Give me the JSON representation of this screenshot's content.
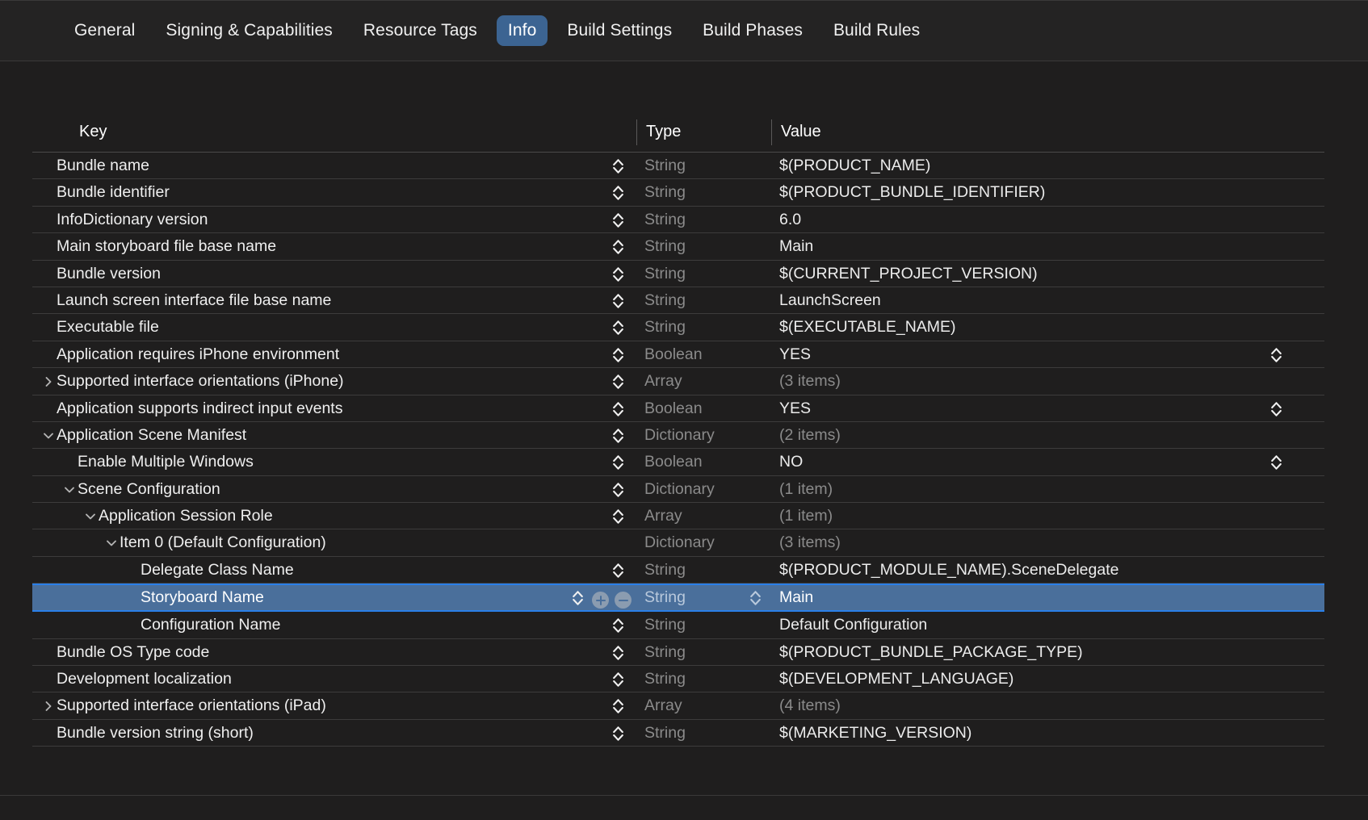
{
  "tabs": [
    {
      "label": "General",
      "active": false
    },
    {
      "label": "Signing & Capabilities",
      "active": false
    },
    {
      "label": "Resource Tags",
      "active": false
    },
    {
      "label": "Info",
      "active": true
    },
    {
      "label": "Build Settings",
      "active": false
    },
    {
      "label": "Build Phases",
      "active": false
    },
    {
      "label": "Build Rules",
      "active": false
    }
  ],
  "table": {
    "headers": {
      "key": "Key",
      "type": "Type",
      "value": "Value"
    },
    "rows": [
      {
        "key": "Bundle name",
        "type": "String",
        "value": "$(PRODUCT_NAME)",
        "indent": 0,
        "disclosure": "none",
        "value_muted": false,
        "selected": false,
        "has_key_stepper": true,
        "has_bool_stepper": false
      },
      {
        "key": "Bundle identifier",
        "type": "String",
        "value": "$(PRODUCT_BUNDLE_IDENTIFIER)",
        "indent": 0,
        "disclosure": "none",
        "value_muted": false,
        "selected": false,
        "has_key_stepper": true,
        "has_bool_stepper": false
      },
      {
        "key": "InfoDictionary version",
        "type": "String",
        "value": "6.0",
        "indent": 0,
        "disclosure": "none",
        "value_muted": false,
        "selected": false,
        "has_key_stepper": true,
        "has_bool_stepper": false
      },
      {
        "key": "Main storyboard file base name",
        "type": "String",
        "value": "Main",
        "indent": 0,
        "disclosure": "none",
        "value_muted": false,
        "selected": false,
        "has_key_stepper": true,
        "has_bool_stepper": false
      },
      {
        "key": "Bundle version",
        "type": "String",
        "value": "$(CURRENT_PROJECT_VERSION)",
        "indent": 0,
        "disclosure": "none",
        "value_muted": false,
        "selected": false,
        "has_key_stepper": true,
        "has_bool_stepper": false
      },
      {
        "key": "Launch screen interface file base name",
        "type": "String",
        "value": "LaunchScreen",
        "indent": 0,
        "disclosure": "none",
        "value_muted": false,
        "selected": false,
        "has_key_stepper": true,
        "has_bool_stepper": false
      },
      {
        "key": "Executable file",
        "type": "String",
        "value": "$(EXECUTABLE_NAME)",
        "indent": 0,
        "disclosure": "none",
        "value_muted": false,
        "selected": false,
        "has_key_stepper": true,
        "has_bool_stepper": false
      },
      {
        "key": "Application requires iPhone environment",
        "type": "Boolean",
        "value": "YES",
        "indent": 0,
        "disclosure": "none",
        "value_muted": false,
        "selected": false,
        "has_key_stepper": true,
        "has_bool_stepper": true
      },
      {
        "key": "Supported interface orientations (iPhone)",
        "type": "Array",
        "value": "(3 items)",
        "indent": 0,
        "disclosure": "collapsed",
        "value_muted": true,
        "selected": false,
        "has_key_stepper": true,
        "has_bool_stepper": false
      },
      {
        "key": "Application supports indirect input events",
        "type": "Boolean",
        "value": "YES",
        "indent": 0,
        "disclosure": "none",
        "value_muted": false,
        "selected": false,
        "has_key_stepper": true,
        "has_bool_stepper": true
      },
      {
        "key": "Application Scene Manifest",
        "type": "Dictionary",
        "value": "(2 items)",
        "indent": 0,
        "disclosure": "expanded",
        "value_muted": true,
        "selected": false,
        "has_key_stepper": true,
        "has_bool_stepper": false
      },
      {
        "key": "Enable Multiple Windows",
        "type": "Boolean",
        "value": "NO",
        "indent": 1,
        "disclosure": "none",
        "value_muted": false,
        "selected": false,
        "has_key_stepper": true,
        "has_bool_stepper": true
      },
      {
        "key": "Scene Configuration",
        "type": "Dictionary",
        "value": "(1 item)",
        "indent": 1,
        "disclosure": "expanded",
        "value_muted": true,
        "selected": false,
        "has_key_stepper": true,
        "has_bool_stepper": false
      },
      {
        "key": "Application Session Role",
        "type": "Array",
        "value": "(1 item)",
        "indent": 2,
        "disclosure": "expanded",
        "value_muted": true,
        "selected": false,
        "has_key_stepper": true,
        "has_bool_stepper": false
      },
      {
        "key": "Item 0 (Default Configuration)",
        "type": "Dictionary",
        "value": "(3 items)",
        "indent": 3,
        "disclosure": "expanded",
        "value_muted": true,
        "selected": false,
        "has_key_stepper": false,
        "has_bool_stepper": false
      },
      {
        "key": "Delegate Class Name",
        "type": "String",
        "value": "$(PRODUCT_MODULE_NAME).SceneDelegate",
        "indent": 4,
        "disclosure": "none",
        "value_muted": false,
        "selected": false,
        "has_key_stepper": true,
        "has_bool_stepper": false
      },
      {
        "key": "Storyboard Name",
        "type": "String",
        "value": "Main",
        "indent": 4,
        "disclosure": "none",
        "value_muted": false,
        "selected": true,
        "has_key_stepper": true,
        "has_bool_stepper": false
      },
      {
        "key": "Configuration Name",
        "type": "String",
        "value": "Default Configuration",
        "indent": 4,
        "disclosure": "none",
        "value_muted": false,
        "selected": false,
        "has_key_stepper": true,
        "has_bool_stepper": false
      },
      {
        "key": "Bundle OS Type code",
        "type": "String",
        "value": "$(PRODUCT_BUNDLE_PACKAGE_TYPE)",
        "indent": 0,
        "disclosure": "none",
        "value_muted": false,
        "selected": false,
        "has_key_stepper": true,
        "has_bool_stepper": false
      },
      {
        "key": "Development localization",
        "type": "String",
        "value": "$(DEVELOPMENT_LANGUAGE)",
        "indent": 0,
        "disclosure": "none",
        "value_muted": false,
        "selected": false,
        "has_key_stepper": true,
        "has_bool_stepper": false
      },
      {
        "key": "Supported interface orientations (iPad)",
        "type": "Array",
        "value": "(4 items)",
        "indent": 0,
        "disclosure": "collapsed",
        "value_muted": true,
        "selected": false,
        "has_key_stepper": true,
        "has_bool_stepper": false
      },
      {
        "key": "Bundle version string (short)",
        "type": "String",
        "value": "$(MARKETING_VERSION)",
        "indent": 0,
        "disclosure": "none",
        "value_muted": false,
        "selected": false,
        "has_key_stepper": true,
        "has_bool_stepper": false
      }
    ],
    "selected_row_buttons": {
      "add": "+",
      "remove": "−"
    }
  },
  "colors": {
    "background": "#1f1e1e",
    "tabbar": "#242323",
    "accent": "#3c6492",
    "selection": "#4a6f9b",
    "selection_border": "#2a7fe8",
    "muted_text": "#8b8b8b"
  }
}
